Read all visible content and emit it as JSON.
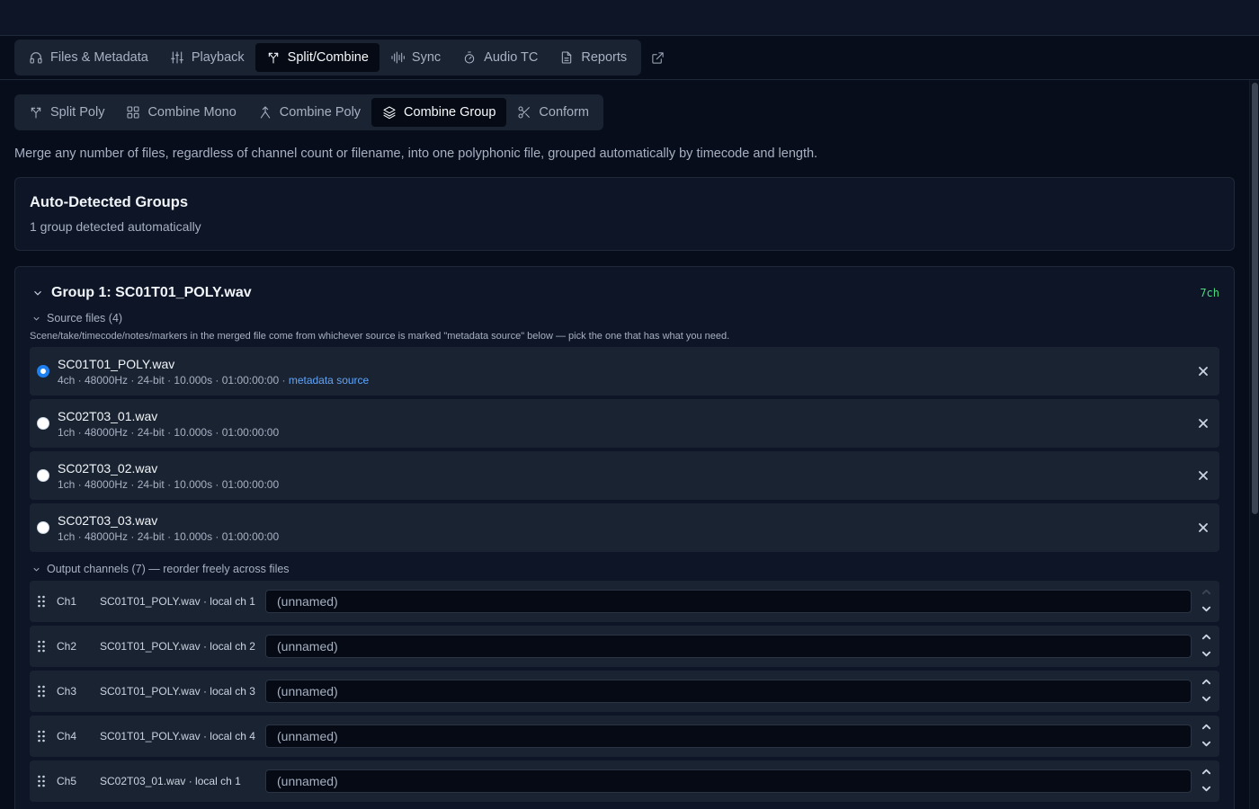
{
  "main_tabs": [
    {
      "label": "Files & Metadata",
      "icon": "headphones-icon",
      "active": false
    },
    {
      "label": "Playback",
      "icon": "sliders-icon",
      "active": false
    },
    {
      "label": "Split/Combine",
      "icon": "split-icon",
      "active": true
    },
    {
      "label": "Sync",
      "icon": "waveform-icon",
      "active": false
    },
    {
      "label": "Audio TC",
      "icon": "timer-icon",
      "active": false
    },
    {
      "label": "Reports",
      "icon": "document-icon",
      "active": false
    }
  ],
  "sub_tabs": [
    {
      "label": "Split Poly",
      "icon": "split-icon",
      "active": false
    },
    {
      "label": "Combine Mono",
      "icon": "grid-icon",
      "active": false
    },
    {
      "label": "Combine Poly",
      "icon": "merge-icon",
      "active": false
    },
    {
      "label": "Combine Group",
      "icon": "layers-icon",
      "active": true
    },
    {
      "label": "Conform",
      "icon": "scissors-icon",
      "active": false
    }
  ],
  "description": "Merge any number of files, regardless of channel count or filename, into one polyphonic file, grouped automatically by timecode and length.",
  "auto_groups": {
    "title": "Auto-Detected Groups",
    "subtitle": "1 group detected automatically"
  },
  "group": {
    "title": "Group 1: SC01T01_POLY.wav",
    "channel_badge": "7ch",
    "source_files_header": "Source files (4)",
    "source_note": "Scene/take/timecode/notes/markers in the merged file come from whichever source is marked \"metadata source\" below — pick the one that has what you need.",
    "files": [
      {
        "name": "SC01T01_POLY.wav",
        "meta": "4ch · 48000Hz · 24-bit · 10.000s · 01:00:00:00",
        "metadata_source": " · metadata source",
        "selected": true
      },
      {
        "name": "SC02T03_01.wav",
        "meta": "1ch · 48000Hz · 24-bit · 10.000s · 01:00:00:00",
        "metadata_source": "",
        "selected": false
      },
      {
        "name": "SC02T03_02.wav",
        "meta": "1ch · 48000Hz · 24-bit · 10.000s · 01:00:00:00",
        "metadata_source": "",
        "selected": false
      },
      {
        "name": "SC02T03_03.wav",
        "meta": "1ch · 48000Hz · 24-bit · 10.000s · 01:00:00:00",
        "metadata_source": "",
        "selected": false
      }
    ],
    "output_header": "Output channels (7) — reorder freely across files",
    "channels": [
      {
        "label": "Ch1",
        "source": "SC01T01_POLY.wav · local ch 1",
        "placeholder": "(unnamed)",
        "up_disabled": true
      },
      {
        "label": "Ch2",
        "source": "SC01T01_POLY.wav · local ch 2",
        "placeholder": "(unnamed)",
        "up_disabled": false
      },
      {
        "label": "Ch3",
        "source": "SC01T01_POLY.wav · local ch 3",
        "placeholder": "(unnamed)",
        "up_disabled": false
      },
      {
        "label": "Ch4",
        "source": "SC01T01_POLY.wav · local ch 4",
        "placeholder": "(unnamed)",
        "up_disabled": false
      },
      {
        "label": "Ch5",
        "source": "SC02T03_01.wav · local ch 1",
        "placeholder": "(unnamed)",
        "up_disabled": false
      }
    ]
  },
  "colors": {
    "background": "#070d1b",
    "accent_blue": "#1d7ff0",
    "link_blue": "#60a5fa",
    "channel_badge_green": "#4ade80"
  }
}
